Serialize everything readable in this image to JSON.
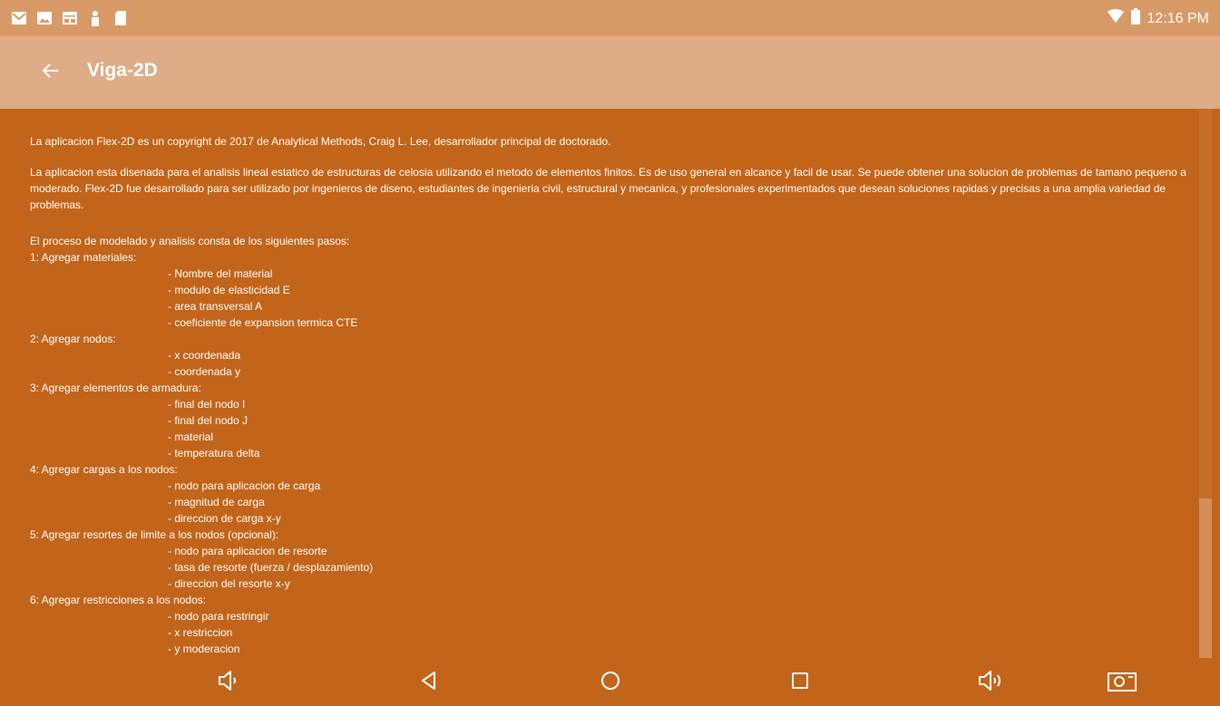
{
  "status_bar": {
    "time": "12:16 PM",
    "left_icons": [
      "gmail-icon",
      "gallery-icon",
      "calendar-icon",
      "app-icon",
      "sdcard-icon"
    ],
    "right_icons": [
      "wifi-icon",
      "battery-icon"
    ]
  },
  "appbar": {
    "title": "Viga-2D",
    "back_icon": "arrow-back-icon"
  },
  "content": {
    "p1": "La aplicacion Flex-2D es un copyright de 2017 de Analytical Methods, Craig L. Lee, desarrollador principal de doctorado.",
    "p2": " La aplicacion esta disenada para el analisis lineal estatico de estructuras de celosia utilizando el metodo de elementos finitos. Es de uso general en alcance y facil de usar. Se puede obtener una solucion de problemas de tamano pequeno a moderado. Flex-2D fue desarrollado para ser utilizado por ingenieros de diseno, estudiantes de ingenieria civil, estructural y mecanica, y profesionales experimentados que desean soluciones rapidas y precisas a una amplia variedad de problemas.",
    "steps_intro": "El proceso de modelado y analisis consta de los siguientes pasos:",
    "steps": [
      {
        "title": "1: Agregar materiales:",
        "items": [
          "- Nombre del material",
          "- modulo de elasticidad E",
          "- area transversal A",
          "- coeficiente de expansion termica CTE"
        ]
      },
      {
        "title": "2: Agregar nodos:",
        "items": [
          "- x coordenada",
          "- coordenada y"
        ]
      },
      {
        "title": "3: Agregar elementos de armadura:",
        "items": [
          "- final del nodo I",
          "- final del nodo J",
          "- material",
          "- temperatura delta"
        ]
      },
      {
        "title": "4: Agregar cargas a los nodos:",
        "items": [
          "- nodo para aplicacion de carga",
          "- magnitud de carga",
          "- direccion de carga x-y"
        ]
      },
      {
        "title": "5: Agregar resortes de limite a los nodos (opcional):",
        "items": [
          "- nodo para aplicacion de resorte",
          "- tasa de resorte (fuerza / desplazamiento)",
          "- direccion del resorte x-y"
        ]
      },
      {
        "title": "6: Agregar restricciones a los nodos:",
        "items": [
          "- nodo para restringir",
          "- x restriccion",
          "- y moderacion"
        ]
      }
    ]
  },
  "scroll": {
    "position_fraction": 0.71
  },
  "navbar": {
    "buttons": [
      "volume-down-icon",
      "back-triangle-icon",
      "home-circle-icon",
      "recents-square-icon",
      "volume-up-icon",
      "screenshot-camera-icon"
    ]
  }
}
